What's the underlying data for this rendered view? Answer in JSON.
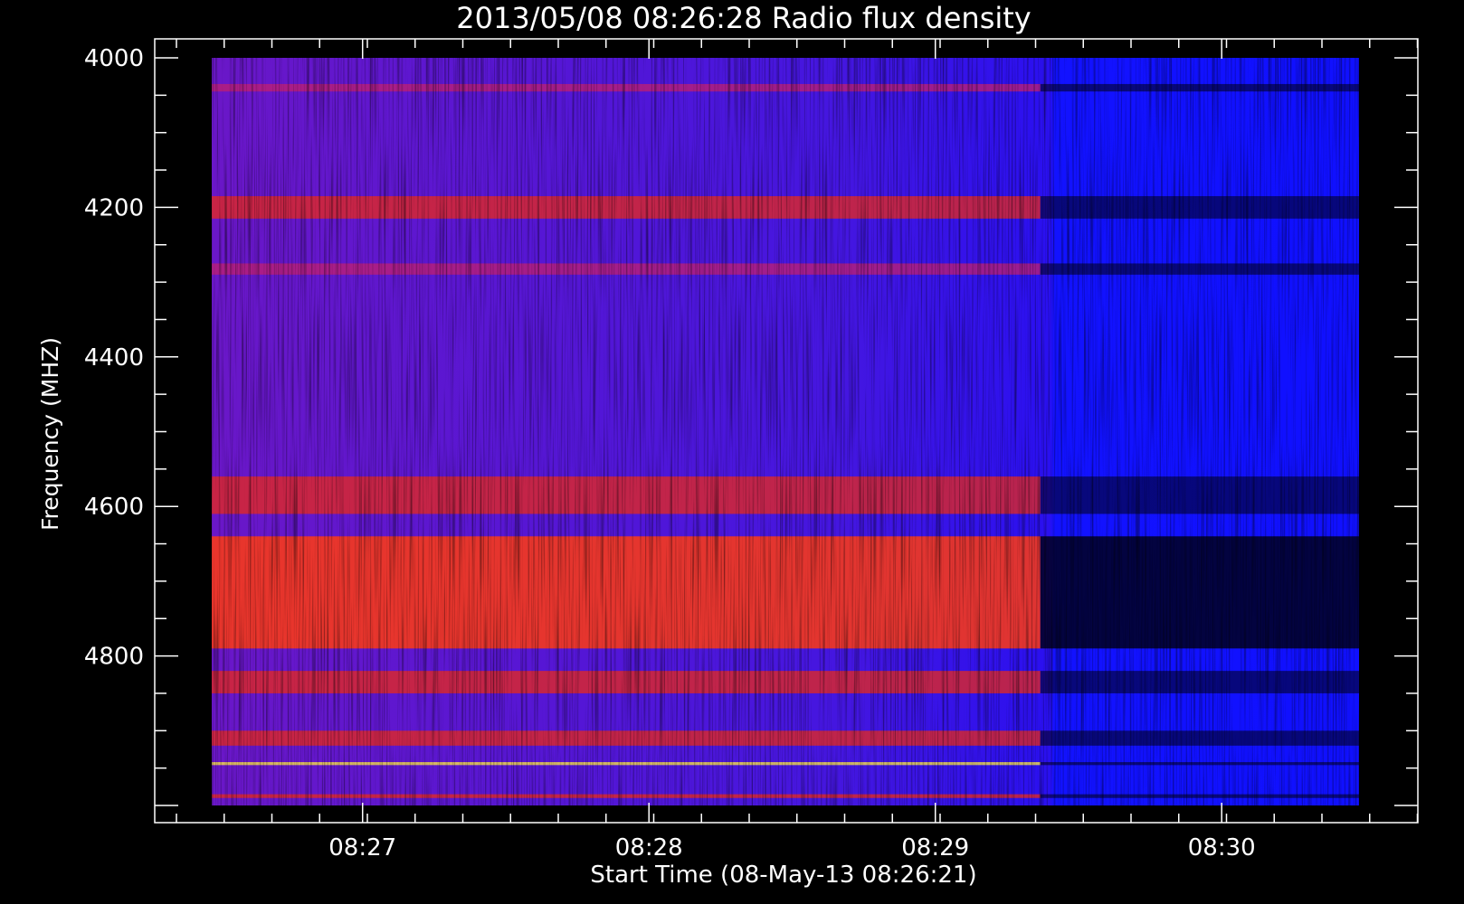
{
  "chart_data": {
    "type": "heatmap",
    "title": "2013/05/08 08:26:28 Radio flux density",
    "xlabel": "Start Time (08-May-13 08:26:21)",
    "ylabel": "Frequency (MHZ)",
    "x_ticks": [
      "08:27",
      "08:28",
      "08:29",
      "08:30"
    ],
    "y_ticks": [
      "4000",
      "4200",
      "4400",
      "4600",
      "4800"
    ],
    "xlim_seconds_after_start": [
      0,
      262
    ],
    "data_x_range_seconds": [
      0,
      262
    ],
    "ylim": [
      4000,
      5000
    ],
    "y_inverted": true,
    "colormap": [
      "#000000",
      "#0000ff",
      "#ff0000",
      "#ffff00"
    ],
    "time_transition": "08:29:22",
    "features": [
      {
        "freq": [
          4035,
          4045
        ],
        "level": "moderate"
      },
      {
        "freq": [
          4185,
          4215
        ],
        "level": "high"
      },
      {
        "freq": [
          4275,
          4290
        ],
        "level": "moderate"
      },
      {
        "freq": [
          4560,
          4610
        ],
        "level": "high"
      },
      {
        "freq": [
          4640,
          4790
        ],
        "level": "very-high"
      },
      {
        "freq": [
          4820,
          4850
        ],
        "level": "high"
      },
      {
        "freq": [
          4900,
          4920
        ],
        "level": "high"
      },
      {
        "freq": [
          4942,
          4946
        ],
        "level": "peak"
      },
      {
        "freq": [
          4985,
          4990
        ],
        "level": "high"
      }
    ]
  }
}
